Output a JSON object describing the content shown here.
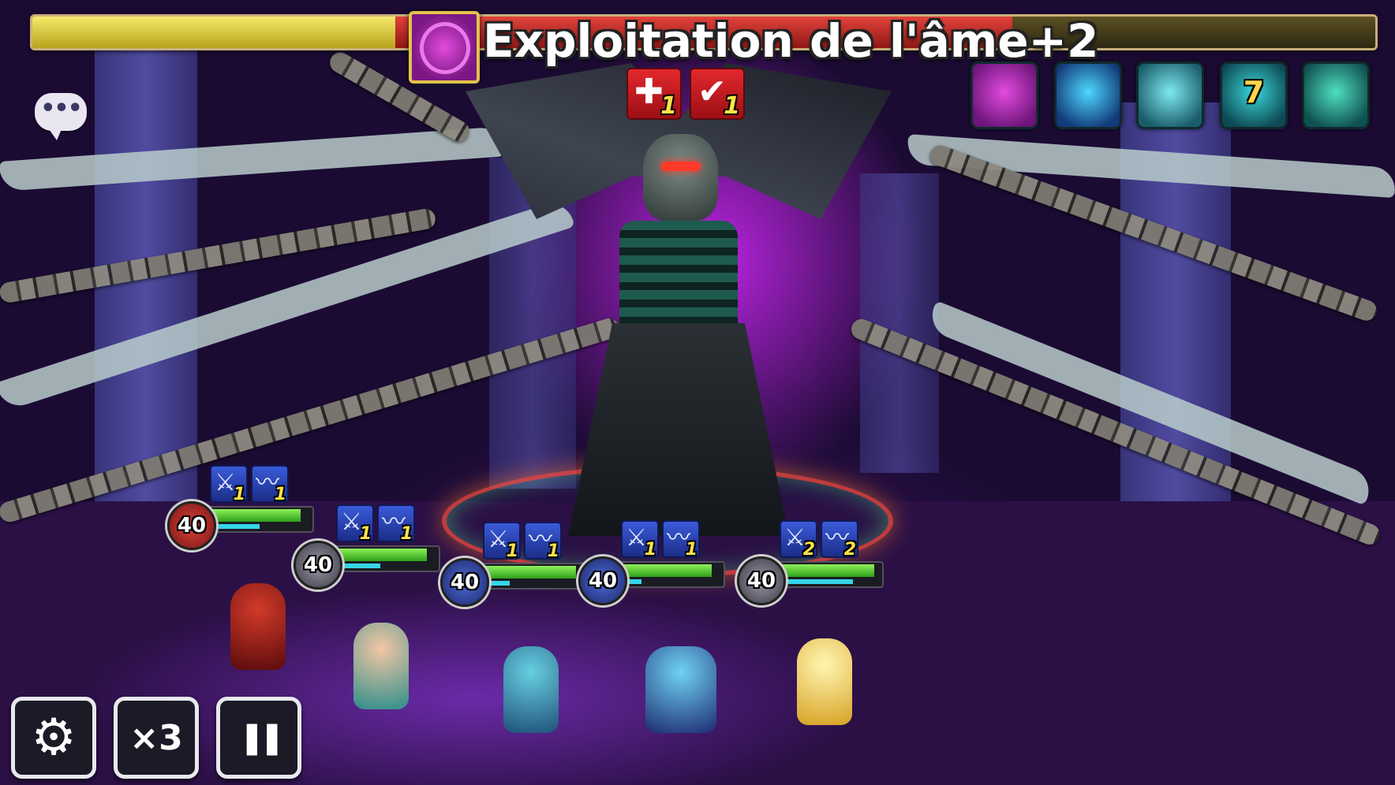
{
  "boss": {
    "name": "Exploitation de l'âme+2",
    "hp_fraction": 0.27,
    "recent_damage_fraction": 0.46,
    "debuffs": [
      {
        "icon": "heal-block-icon",
        "glyph": "✚",
        "turns": "1"
      },
      {
        "icon": "defense-break-icon",
        "glyph": "✔",
        "turns": "1"
      }
    ],
    "skills": [
      {
        "icon": "soul-seal-icon",
        "colors": [
          "#e34bdf",
          "#6d157a"
        ],
        "label": ""
      },
      {
        "icon": "spirit-figure-icon",
        "colors": [
          "#4ed7ff",
          "#123a78"
        ],
        "label": ""
      },
      {
        "icon": "crypt-gate-icon",
        "colors": [
          "#7fe9f2",
          "#1a5d6a"
        ],
        "label": ""
      },
      {
        "icon": "cooldown-rune-icon",
        "colors": [
          "#3ad8d8",
          "#0e4a55"
        ],
        "label": "7"
      },
      {
        "icon": "spider-emblem-icon",
        "colors": [
          "#4fe0c0",
          "#0f5150"
        ],
        "label": ""
      }
    ]
  },
  "chat": {
    "label": "•••"
  },
  "units": [
    {
      "level": "40",
      "orb": "red",
      "hp": 0.9,
      "atb": 0.55,
      "buffs": [
        {
          "icon": "attack-up-icon",
          "glyph": "⚔",
          "turns": "1"
        },
        {
          "icon": "speed-up-icon",
          "glyph": "〰",
          "turns": "1"
        }
      ]
    },
    {
      "level": "40",
      "orb": "grey",
      "hp": 0.9,
      "atb": 0.5,
      "buffs": [
        {
          "icon": "attack-up-icon",
          "glyph": "⚔",
          "turns": "1"
        },
        {
          "icon": "speed-up-icon",
          "glyph": "〰",
          "turns": "1"
        }
      ]
    },
    {
      "level": "40",
      "orb": "blue",
      "hp": 0.92,
      "atb": 0.35,
      "buffs": [
        {
          "icon": "attack-up-icon",
          "glyph": "⚔",
          "turns": "1"
        },
        {
          "icon": "speed-up-icon",
          "glyph": "〰",
          "turns": "1"
        }
      ]
    },
    {
      "level": "40",
      "orb": "blue",
      "hp": 0.9,
      "atb": 0.3,
      "buffs": [
        {
          "icon": "attack-up-icon",
          "glyph": "⚔",
          "turns": "1"
        },
        {
          "icon": "speed-up-icon",
          "glyph": "〰",
          "turns": "1"
        }
      ]
    },
    {
      "level": "40",
      "orb": "grey",
      "hp": 0.93,
      "atb": 0.75,
      "buffs": [
        {
          "icon": "attack-up-icon",
          "glyph": "⚔",
          "turns": "2"
        },
        {
          "icon": "speed-up-icon",
          "glyph": "〰",
          "turns": "2"
        }
      ]
    }
  ],
  "controls": {
    "settings_glyph": "⚙",
    "speed_label": "×3",
    "pause_glyph": "❚❚"
  },
  "colors": {
    "accent": "#d628ff",
    "hp_green": "#2ea018",
    "atb_cyan": "#35d6e8",
    "buff_blue": "#3a5bd9",
    "debuff_red": "#e3282e"
  }
}
